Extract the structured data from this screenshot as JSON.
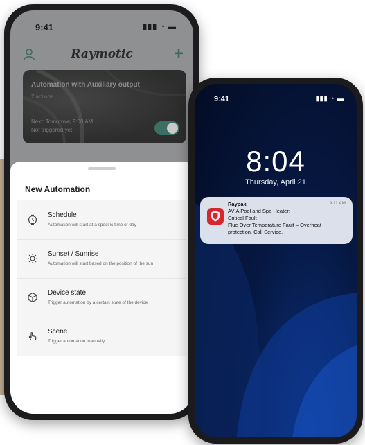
{
  "phone_left": {
    "status": {
      "time": "9:41",
      "icons": "▮▮▮ ◔ ▬"
    },
    "nav": {
      "brand": "Raymotic",
      "user_icon": "user-icon",
      "add_icon": "plus-icon"
    },
    "card": {
      "title": "Automation with Auxiliary output",
      "subtitle": "2 actions",
      "schedule": "Next: Tomorrow, 9:00 AM",
      "status": "Not triggered yet",
      "toggle_on": true
    },
    "sheet": {
      "title": "New Automation",
      "items": [
        {
          "icon": "clock-icon",
          "label": "Schedule",
          "desc": "Automation will start at a specific time of day"
        },
        {
          "icon": "sun-icon",
          "label": "Sunset / Sunrise",
          "desc": "Automation will start based on the position of the sun"
        },
        {
          "icon": "cube-icon",
          "label": "Device state",
          "desc": "Trigger automation by a certain state of the device"
        },
        {
          "icon": "hand-tap-icon",
          "label": "Scene",
          "desc": "Trigger automation manually"
        }
      ]
    }
  },
  "phone_right": {
    "status": {
      "time": "9:41",
      "icons": "▮▮▮ ◔ ▬"
    },
    "lock_time": "8:04",
    "lock_date": "Thursday, April 21",
    "notification": {
      "app": "Raypak",
      "time": "9:11 AM",
      "lines": [
        "AVIA Pool and Spa Heater:",
        "Critical Fault",
        "Flue Over Temperature Fault – Overheat",
        "protection. Call Service."
      ],
      "icon_color": "#d7262d"
    }
  },
  "colors": {
    "accent": "#3c6f64",
    "lock_bg": "#061842"
  }
}
